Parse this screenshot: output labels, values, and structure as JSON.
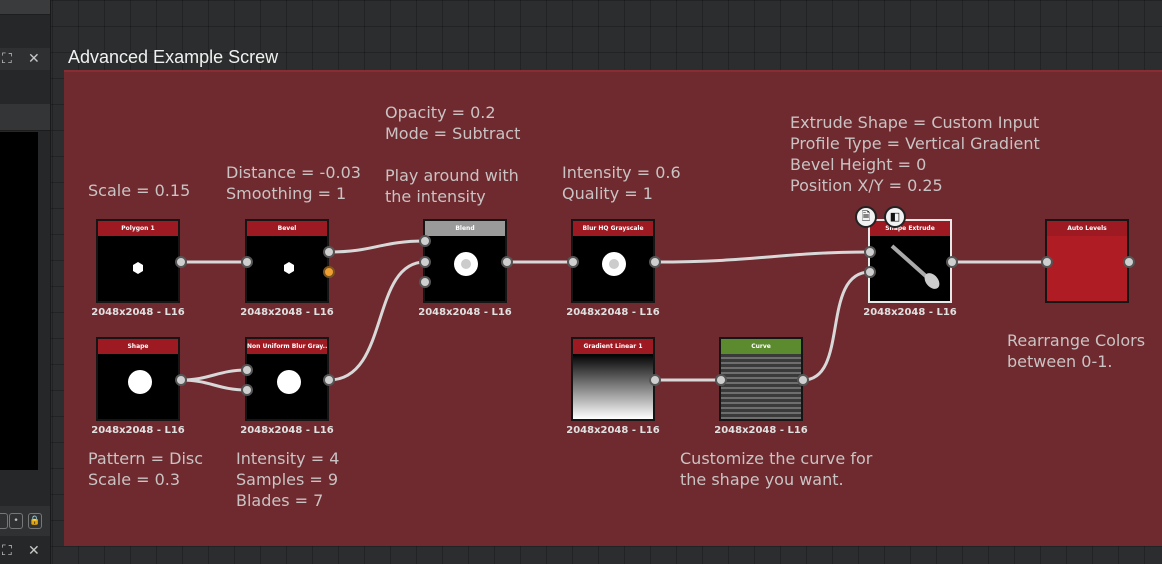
{
  "frame": {
    "title": "Advanced Example Screw",
    "color": "#6e2a2f"
  },
  "left_panel": {
    "top_icons": {
      "maximize": "⛶",
      "close": "✕"
    },
    "bottom_icons": {
      "maximize": "⛶",
      "close": "✕"
    },
    "toggles": [
      "•",
      "🔒"
    ]
  },
  "nodes": {
    "polygon": {
      "title": "Polygon 1",
      "res": "2048x2048 - L16"
    },
    "bevel": {
      "title": "Bevel",
      "res": "2048x2048 - L16"
    },
    "blend": {
      "title": "Blend",
      "res": "2048x2048 - L16"
    },
    "blur_hq": {
      "title": "Blur HQ Grayscale",
      "res": "2048x2048 - L16"
    },
    "shape_extrude": {
      "title": "Shape Extrude",
      "res": "2048x2048 - L16"
    },
    "auto_levels": {
      "title": "Auto Levels"
    },
    "shape": {
      "title": "Shape",
      "res": "2048x2048 - L16"
    },
    "non_uniform_blur": {
      "title": "Non Uniform Blur Gray...",
      "res": "2048x2048 - L16"
    },
    "gradient_linear": {
      "title": "Gradient Linear 1",
      "res": "2048x2048 - L16"
    },
    "curve": {
      "title": "Curve",
      "res": "2048x2048 - L16"
    }
  },
  "comments": {
    "scale": "Scale = 0.15",
    "bevel": "Distance = -0.03\nSmoothing = 1",
    "blend": "Opacity = 0.2\nMode = Subtract\n\nPlay around with\nthe intensity",
    "blur": "Intensity = 0.6\nQuality = 1",
    "extrude": "Extrude Shape = Custom Input\nProfile Type = Vertical Gradient\nBevel Height = 0\nPosition X/Y = 0.25",
    "auto_levels": "Rearrange Colors\nbetween 0-1.",
    "shape": "Pattern = Disc\nScale = 0.3",
    "nublur": "Intensity = 4\nSamples = 9\nBlades = 7",
    "curve": "Customize the curve for\nthe shape you want."
  },
  "badges": {
    "doc": "🗎",
    "grid": "◧"
  }
}
